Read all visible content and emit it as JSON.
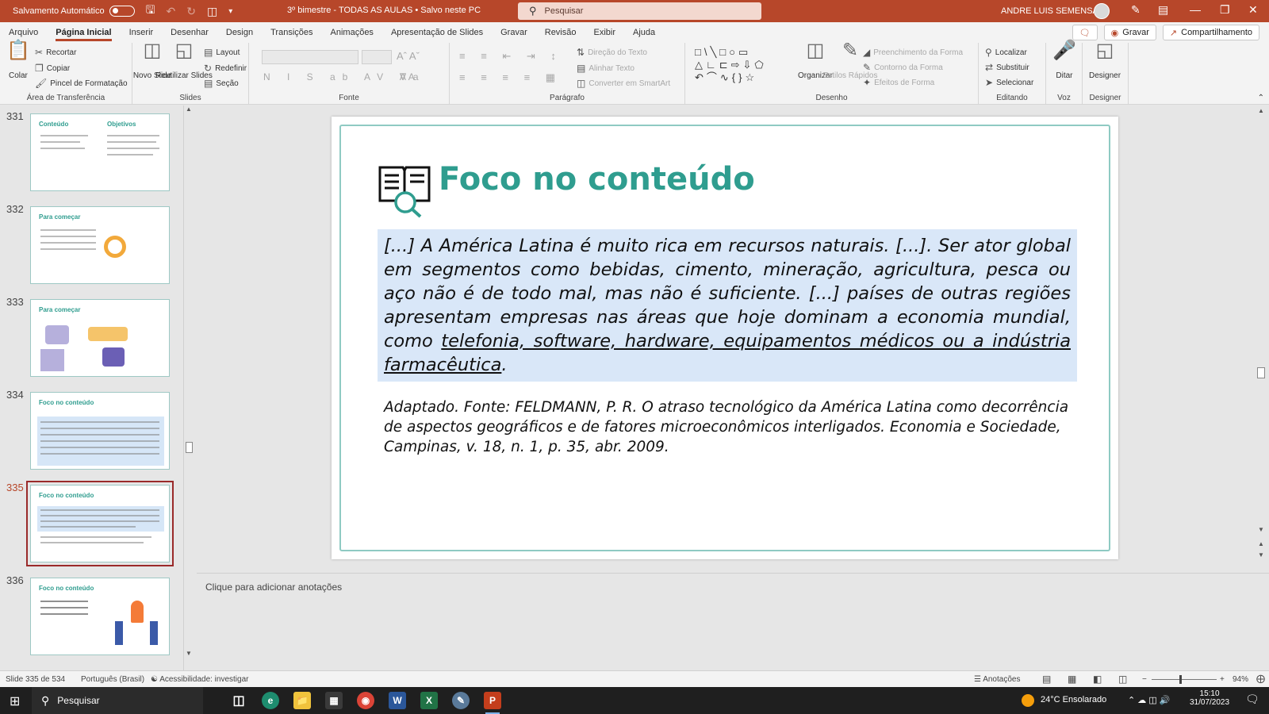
{
  "titlebar": {
    "autosave_label": "Salvamento Automático",
    "doc_title": "3º bimestre - TODAS AS AULAS • Salvo neste PC",
    "search_placeholder": "Pesquisar",
    "user_name": "ANDRE LUIS SEMENSATO"
  },
  "menu": {
    "tabs": [
      "Arquivo",
      "Página Inicial",
      "Inserir",
      "Desenhar",
      "Design",
      "Transições",
      "Animações",
      "Apresentação de Slides",
      "Gravar",
      "Revisão",
      "Exibir",
      "Ajuda"
    ],
    "active_tab": "Página Inicial",
    "record_label": "Gravar",
    "share_label": "Compartilhamento"
  },
  "ribbon": {
    "clipboard": {
      "label": "Área de Transferência",
      "paste": "Colar",
      "cut": "Recortar",
      "copy": "Copiar",
      "format_painter": "Pincel de Formatação"
    },
    "slides": {
      "label": "Slides",
      "new_slide": "Novo Slide",
      "reuse": "Reutilizar Slides",
      "layout": "Layout",
      "reset": "Redefinir",
      "section": "Seção"
    },
    "font": {
      "label": "Fonte"
    },
    "paragraph": {
      "label": "Parágrafo",
      "text_direction": "Direção do Texto",
      "align_text": "Alinhar Texto",
      "smartart": "Converter em SmartArt"
    },
    "drawing": {
      "label": "Desenho",
      "arrange": "Organizar",
      "quick_styles": "Estilos Rápidos",
      "fill": "Preenchimento da Forma",
      "outline": "Contorno da Forma",
      "effects": "Efeitos de Forma"
    },
    "editing": {
      "label": "Editando",
      "find": "Localizar",
      "replace": "Substituir",
      "select": "Selecionar"
    },
    "voice": {
      "label": "Voz",
      "dictate": "Ditar"
    },
    "designer": {
      "label": "Designer",
      "designer": "Designer"
    }
  },
  "thumbnails": [
    {
      "num": "331",
      "title": "Conteúdo",
      "title2": "Objetivos"
    },
    {
      "num": "332",
      "title": "Para começar"
    },
    {
      "num": "333",
      "title": "Para começar"
    },
    {
      "num": "334",
      "title": "Foco no conteúdo"
    },
    {
      "num": "335",
      "title": "Foco no conteúdo"
    },
    {
      "num": "336",
      "title": "Foco no conteúdo"
    }
  ],
  "slide": {
    "title": "Foco no conteúdo",
    "quote_part1": "[...] A América Latina é muito rica em recursos naturais. [...]. Ser ator global em segmentos como bebidas, cimento, mineração, agricultura, pesca ou aço não é de todo mal, mas não é suficiente. [...] países de outras regiões apresentam empresas nas áreas que hoje dominam a economia mundial, como ",
    "quote_underlined": "telefonia, software, hardware, equipamentos médicos ou a indústria farmacêutica",
    "quote_end": ".",
    "source": "Adaptado. Fonte: FELDMANN, P. R. O atraso tecnológico da América Latina como decorrência de aspectos geográficos e de fatores microeconômicos interligados. Economia e Sociedade, Campinas, v. 18, n. 1, p. 35, abr. 2009."
  },
  "notes": {
    "placeholder": "Clique para adicionar anotações"
  },
  "status": {
    "slide_count": "Slide 335 de 534",
    "language": "Português (Brasil)",
    "accessibility": "Acessibilidade: investigar",
    "notes_button": "Anotações",
    "zoom": "94%"
  },
  "taskbar": {
    "search_placeholder": "Pesquisar",
    "weather": "24°C  Ensolarado",
    "time": "15:10",
    "date": "31/07/2023"
  },
  "colors": {
    "accent": "#b7472a",
    "teal": "#2f9d8f",
    "quote_bg": "#d9e7f8"
  }
}
